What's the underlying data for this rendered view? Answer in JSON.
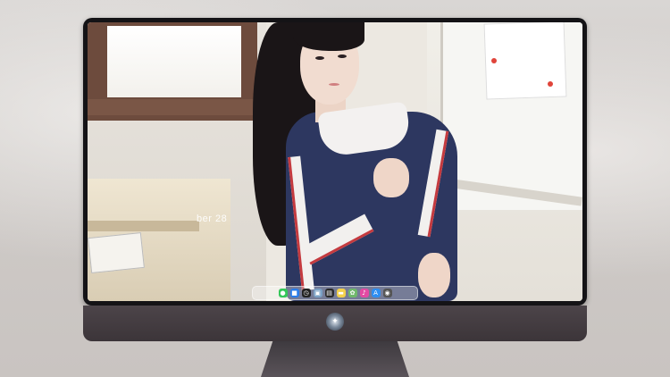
{
  "desktop": {
    "date_text": "ber 28",
    "date_sub": ""
  },
  "dock": {
    "icons": [
      {
        "name": "messages-icon",
        "glyph": "●",
        "color": "#34c759"
      },
      {
        "name": "finder-icon",
        "glyph": "■",
        "color": "#2b7de9"
      },
      {
        "name": "clock-icon",
        "glyph": "◷",
        "color": "#222222"
      },
      {
        "name": "preview-icon",
        "glyph": "▣",
        "color": "#7aa0c4"
      },
      {
        "name": "clapper-icon",
        "glyph": "▤",
        "color": "#2b2b2b"
      },
      {
        "name": "notes-icon",
        "glyph": "▬",
        "color": "#f3d14a"
      },
      {
        "name": "photos-icon",
        "glyph": "✿",
        "color": "#6fb86b"
      },
      {
        "name": "music-icon",
        "glyph": "♪",
        "color": "#e34aa3"
      },
      {
        "name": "appstore-icon",
        "glyph": "A",
        "color": "#2e8ef0"
      },
      {
        "name": "camera-icon",
        "glyph": "◉",
        "color": "#555555"
      }
    ]
  },
  "logo": {
    "glyph": "✦"
  }
}
